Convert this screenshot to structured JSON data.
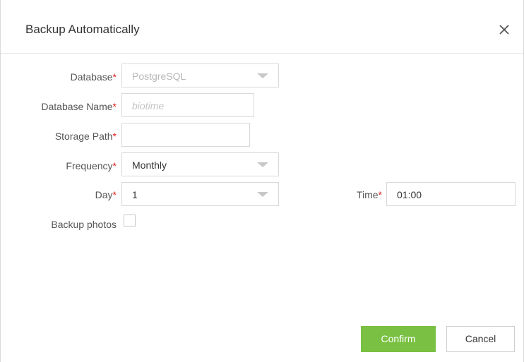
{
  "dialog": {
    "title": "Backup Automatically",
    "close_icon": "close-icon"
  },
  "form": {
    "required_mark": "*",
    "database": {
      "label": "Database",
      "value": "PostgreSQL"
    },
    "database_name": {
      "label": "Database Name",
      "placeholder": "biotime"
    },
    "storage_path": {
      "label": "Storage Path",
      "value": ""
    },
    "frequency": {
      "label": "Frequency",
      "value": "Monthly"
    },
    "day": {
      "label": "Day",
      "value": "1"
    },
    "time": {
      "label": "Time",
      "value": "01:00"
    },
    "backup_photos": {
      "label": "Backup photos",
      "checked": false
    }
  },
  "footer": {
    "confirm_label": "Confirm",
    "cancel_label": "Cancel"
  },
  "colors": {
    "accent": "#7ac143",
    "required": "#e02020"
  }
}
